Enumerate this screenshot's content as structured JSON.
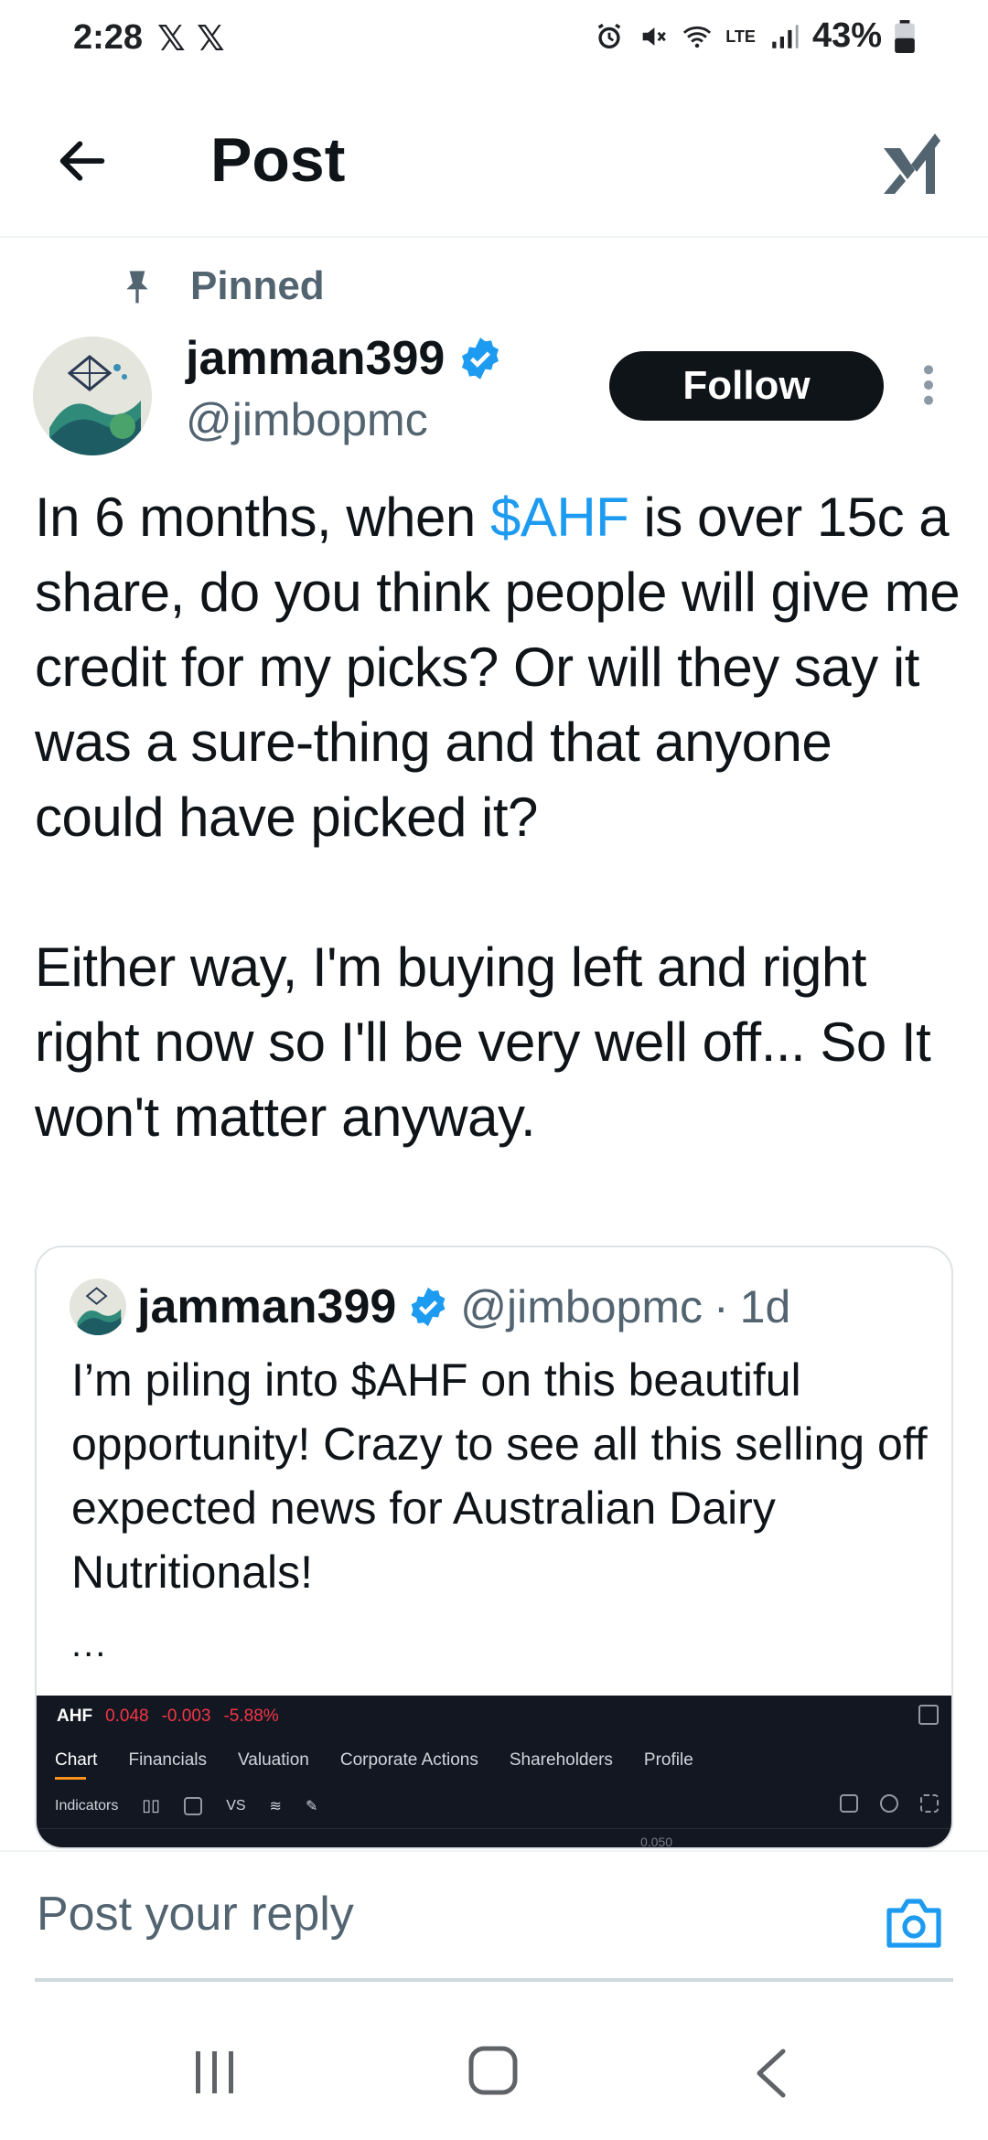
{
  "status_bar": {
    "time": "2:28",
    "notif_x1": "𝕏",
    "notif_x2": "𝕏",
    "network": "LTE",
    "battery": "43%"
  },
  "header": {
    "title": "Post",
    "back_icon": "arrow-left-icon",
    "grok_icon": "grok-icon"
  },
  "post": {
    "pinned_label": "Pinned",
    "author_name": "jamman399",
    "author_handle": "@jimbopmc",
    "follow_label": "Follow",
    "text_part1": "In 6 months, when ",
    "cashtag": "$AHF",
    "text_part2": " is over 15c a share, do you think people will give me credit for my picks? Or will they say it was a sure-thing and that anyone could have picked it?",
    "text_para2": "Either way, I'm buying left and right right now so I'll be very well off... So It won't matter anyway."
  },
  "quote": {
    "author_name": "jamman399",
    "author_handle": "@jimbopmc",
    "separator": "·",
    "time": "1d",
    "text": "I’m piling into $AHF on this beautiful opportunity! Crazy to see all this selling off expected news for Australian Dairy Nutritionals!",
    "ellipsis": "...",
    "image": {
      "symbol": "AHF",
      "price": "0.048",
      "change": "-0.003",
      "change_pct": "-5.88%",
      "tabs": [
        "Chart",
        "Financials",
        "Valuation",
        "Corporate Actions",
        "Shareholders",
        "Profile"
      ],
      "tools_indicators": "Indicators",
      "tools_vs": "VS",
      "axis_value": "0.050"
    }
  },
  "reply": {
    "placeholder": "Post your reply"
  },
  "colors": {
    "accent": "#1d9bf0",
    "text": "#0f1419",
    "muted": "#536471"
  }
}
